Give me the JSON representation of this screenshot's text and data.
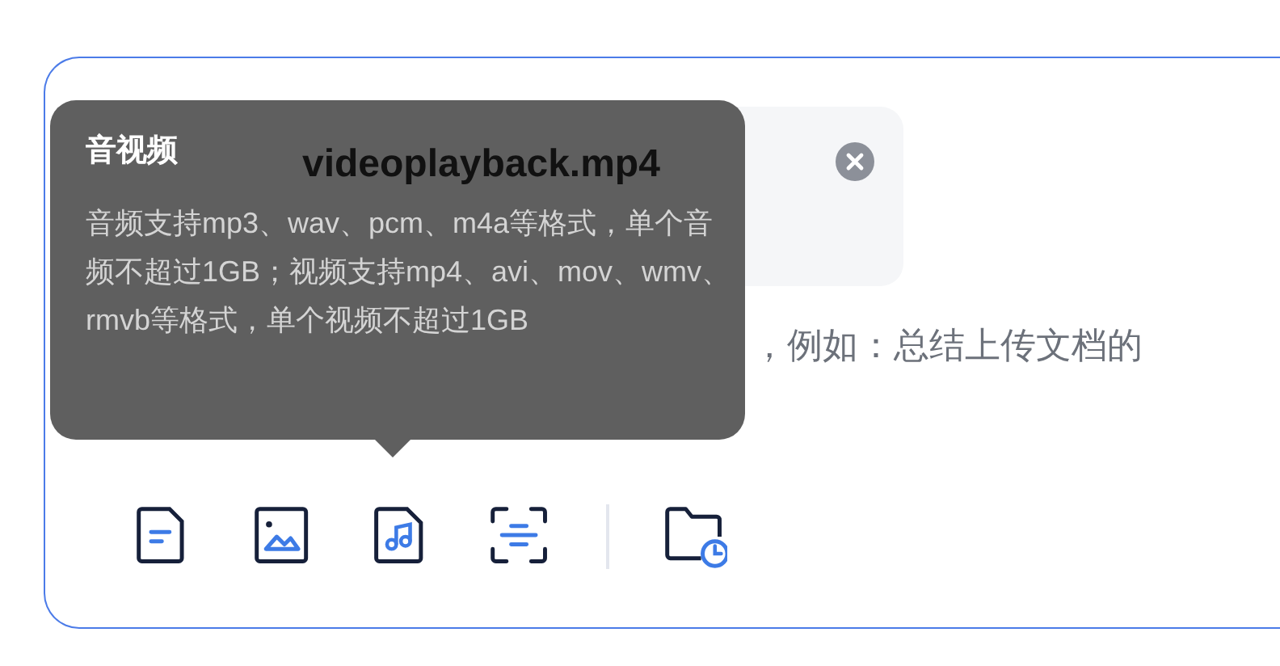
{
  "attachment": {
    "file_name": "videoplayback.mp4"
  },
  "input": {
    "placeholder": "，例如：总结上传文档的"
  },
  "toolbar": [
    {
      "kind": "document"
    },
    {
      "kind": "image"
    },
    {
      "kind": "audio"
    },
    {
      "kind": "scan"
    },
    {
      "kind": "divider"
    },
    {
      "kind": "history"
    }
  ],
  "tooltip": {
    "title": "音视频",
    "text": "音频支持mp3、wav、pcm、m4a等格式，单个音频不超过1GB；视频支持mp4、avi、mov、wmv、rmvb等格式，单个视频不超过1GB"
  }
}
